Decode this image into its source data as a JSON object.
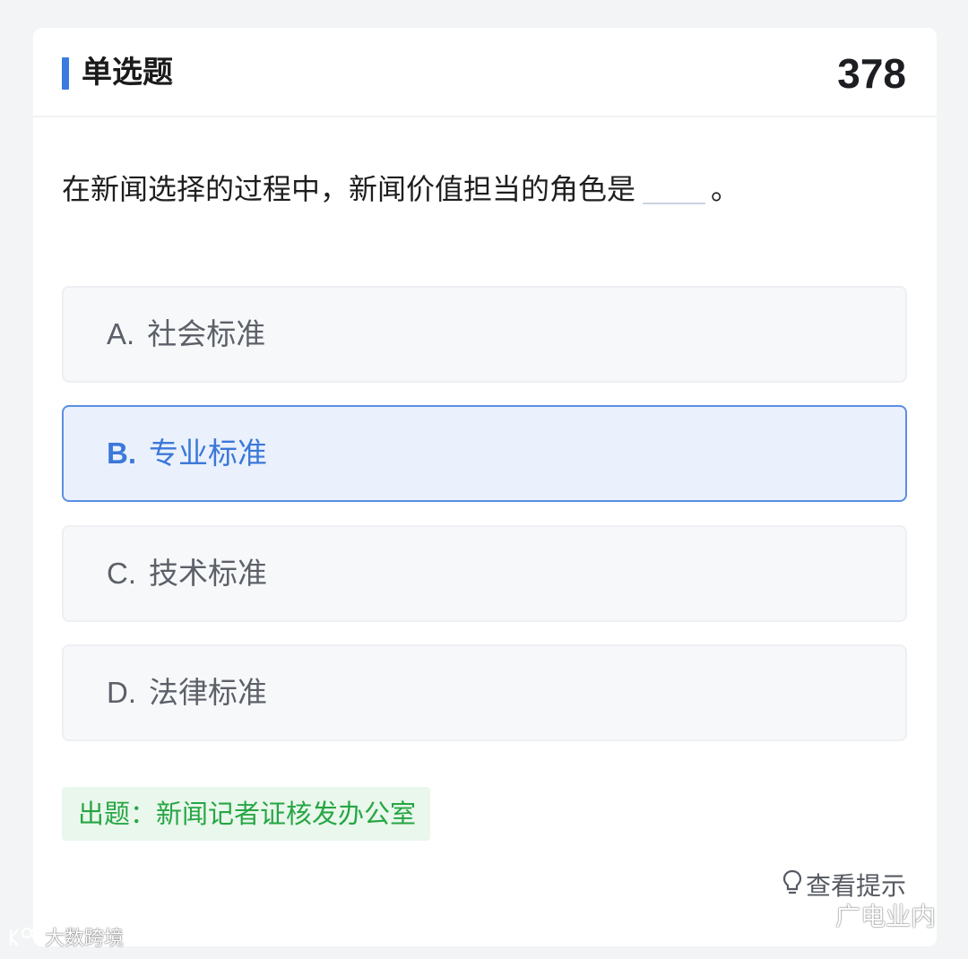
{
  "header": {
    "title": "单选题",
    "number": "378"
  },
  "question": {
    "text_before": "在新闻选择的过程中，新闻价值担当的角色是",
    "text_after": "。"
  },
  "options": [
    {
      "letter": "A.",
      "text": "社会标准",
      "selected": false
    },
    {
      "letter": "B.",
      "text": "专业标准",
      "selected": true
    },
    {
      "letter": "C.",
      "text": "技术标准",
      "selected": false
    },
    {
      "letter": "D.",
      "text": "法律标准",
      "selected": false
    }
  ],
  "source": {
    "label": "出题：新闻记者证核发办公室"
  },
  "hint": {
    "label": "查看提示",
    "icon": "lightbulb-icon"
  },
  "watermarks": {
    "right": "广电业内",
    "right_icon": "wechat-icon",
    "left": "大数跨境",
    "left_icon": "brand-logo-icon"
  },
  "colors": {
    "accent": "#3b7be0",
    "selected_bg": "#eaf1fd",
    "selected_border": "#5a8fe4",
    "source_green": "#27a644",
    "source_bg": "#e9f7ec"
  }
}
